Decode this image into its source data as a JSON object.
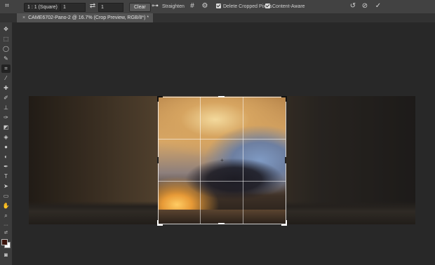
{
  "options_bar": {
    "ratio_preset": "1 : 1 (Square)",
    "width_value": "1",
    "height_value": "1",
    "clear_label": "Clear",
    "straighten_label": "Straighten",
    "delete_cropped_label": "Delete Cropped Pixels",
    "content_aware_label": "Content-Aware",
    "delete_cropped_checked": true,
    "content_aware_checked": true
  },
  "document_tab": {
    "title": "CAME6702-Pano-2 @ 16.7% (Crop Preview, RGB/8*) *"
  },
  "tools": [
    "move-tool",
    "marquee-tool",
    "lasso-tool",
    "quick-select-tool",
    "crop-tool",
    "eyedropper-tool",
    "healing-brush-tool",
    "brush-tool",
    "clone-stamp-tool",
    "history-brush-tool",
    "eraser-tool",
    "paint-bucket-tool",
    "blur-tool",
    "dodge-tool",
    "pen-tool",
    "type-tool",
    "path-select-tool",
    "rectangle-tool",
    "hand-tool",
    "zoom-tool"
  ],
  "colors": {
    "foreground": "#3a140c",
    "background": "#ffffff"
  }
}
